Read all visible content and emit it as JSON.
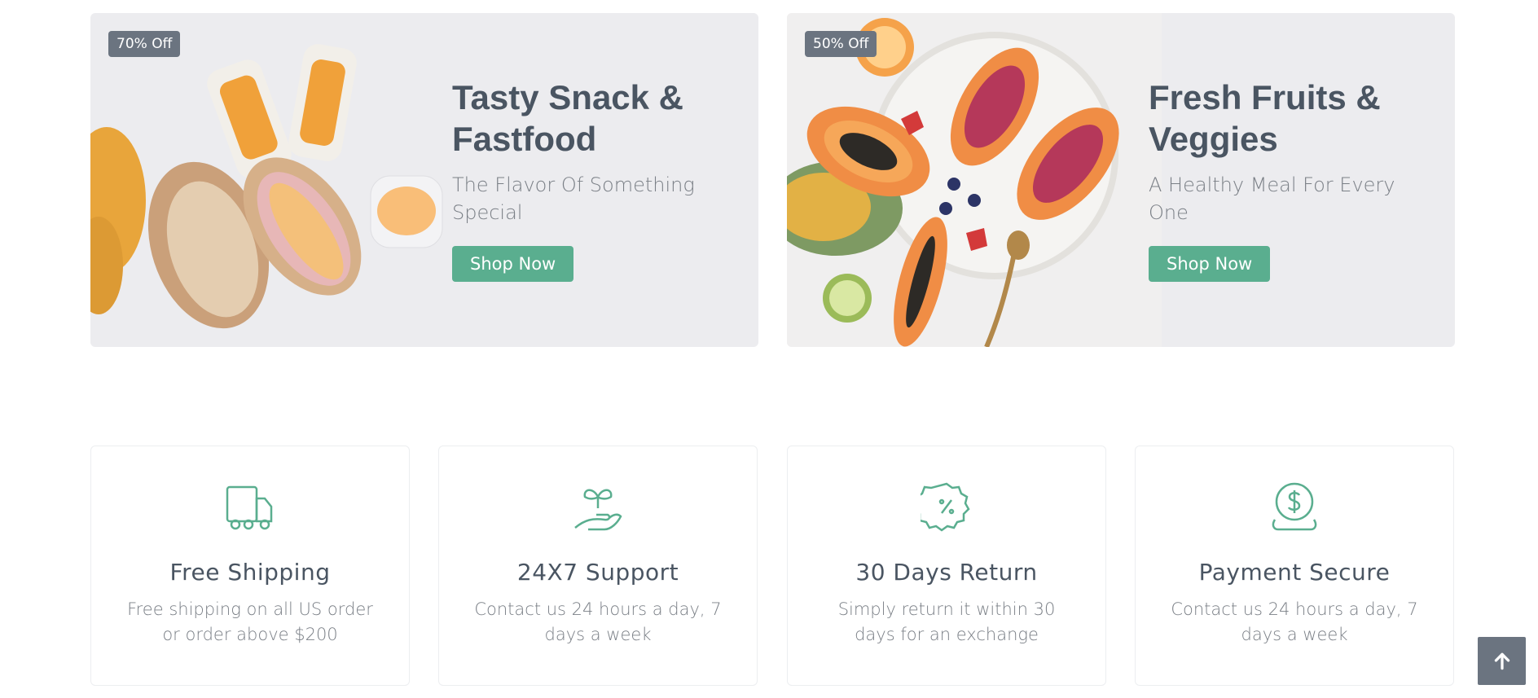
{
  "banners": [
    {
      "badge": "70% Off",
      "title": "Tasty Snack & Fastfood",
      "subtitle": "The Flavor Of Something Special",
      "button": "Shop Now",
      "image_icon": "sandwich-image"
    },
    {
      "badge": "50% Off",
      "title": "Fresh Fruits & Veggies",
      "subtitle": "A Healthy Meal For Every One",
      "button": "Shop Now",
      "image_icon": "papaya-image"
    }
  ],
  "features": [
    {
      "icon": "truck-icon",
      "title": "Free Shipping",
      "text": "Free shipping on all US order or order above $200"
    },
    {
      "icon": "plant-hand-icon",
      "title": "24X7 Support",
      "text": "Contact us 24 hours a day, 7 days a week"
    },
    {
      "icon": "percent-badge-icon",
      "title": "30 Days Return",
      "text": "Simply return it within 30 days for an exchange"
    },
    {
      "icon": "dollar-coin-icon",
      "title": "Payment Secure",
      "text": "Contact us 24 hours a day, 7 days a week"
    }
  ],
  "scroll_top_icon": "arrow-up-icon",
  "colors": {
    "accent": "#5aae8f",
    "badge": "#6b7480",
    "banner_bg": "#ececef",
    "heading": "#4a5562",
    "body_text": "#7a7f86"
  }
}
